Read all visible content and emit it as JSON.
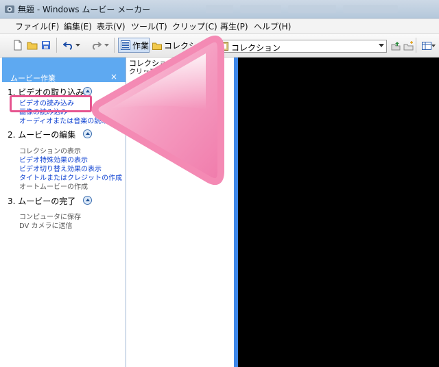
{
  "window": {
    "title": "無題 - Windows ムービー メーカー"
  },
  "menu": {
    "items": [
      "ファイル(F)",
      "編集(E)",
      "表示(V)",
      "ツール(T)",
      "クリップ(C)",
      "再生(P)",
      "ヘルプ(H)"
    ]
  },
  "toolbar": {
    "task_label": "作業",
    "collections_label": "コレクショ",
    "collection_select": "コレクション"
  },
  "task_pane": {
    "title": "ムービー作業",
    "close": "×",
    "sections": [
      {
        "title": "1. ビデオの取り込み",
        "links": [
          "ビデオの読み込み",
          "画像の読み込み",
          "オーディオまたは音楽の読み込み"
        ],
        "static": []
      },
      {
        "title": "2. ムービーの編集",
        "links": [
          "ビデオ特殊効果の表示",
          "ビデオ切り替え効果の表示",
          "タイトルまたはクレジットの作成"
        ],
        "static": [
          "コレクションの表示",
          "オートムービーの作成"
        ]
      },
      {
        "title": "3. ムービーの完了",
        "links": [],
        "static": [
          "コンピュータに保存",
          "DV カメラに送信"
        ]
      }
    ]
  },
  "collection_pane": {
    "title": "コレクション",
    "subtitle": "クリップ"
  },
  "colors": {
    "accent_blue": "#5ea9f1",
    "highlight_pink": "#e6558f",
    "link_blue": "#0b3fd1",
    "preview_bg": "#000000"
  },
  "icons": [
    "app-icon",
    "new-icon",
    "open-icon",
    "save-icon",
    "undo-icon",
    "redo-icon",
    "tasks-icon",
    "folder-icon",
    "up-icon",
    "new-folder-icon",
    "view-icon",
    "collapse-icon"
  ]
}
